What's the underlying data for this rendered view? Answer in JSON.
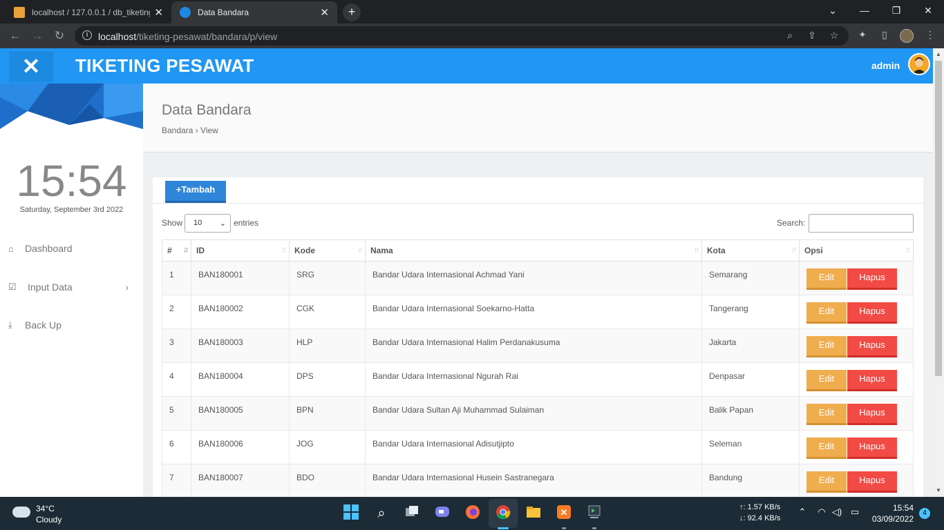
{
  "browser": {
    "tabs": [
      {
        "label": "localhost / 127.0.0.1 / db_tiketing",
        "active": false
      },
      {
        "label": "Data Bandara",
        "active": true
      }
    ],
    "url_host": "localhost",
    "url_path": "/tiketing-pesawat/bandara/p/view"
  },
  "app": {
    "brand": "TIKETING PESAWAT",
    "user": "admin",
    "accent": "#2196f3"
  },
  "sidebar": {
    "clock": "15:54",
    "date": "Saturday, September 3rd 2022",
    "items": [
      {
        "label": "Dashboard",
        "icon": "home-icon"
      },
      {
        "label": "Input Data",
        "icon": "checkbox-icon"
      },
      {
        "label": "Back Up",
        "icon": "download-icon"
      }
    ]
  },
  "header": {
    "title": "Data Bandara",
    "breadcrumb": "Bandara › View"
  },
  "panel": {
    "add_label": "+Tambah",
    "show_label": "Show",
    "entries_label": "entries",
    "entries_value": "10",
    "search_label": "Search:",
    "columns": [
      "#",
      "ID",
      "Kode",
      "Nama",
      "Kota",
      "Opsi"
    ],
    "edit_label": "Edit",
    "delete_label": "Hapus",
    "rows": [
      {
        "no": "1",
        "id": "BAN180001",
        "kode": "SRG",
        "nama": "Bandar Udara Internasional Achmad Yani",
        "kota": "Semarang"
      },
      {
        "no": "2",
        "id": "BAN180002",
        "kode": "CGK",
        "nama": "Bandar Udara Internasional Soekarno-Hatta",
        "kota": "Tangerang"
      },
      {
        "no": "3",
        "id": "BAN180003",
        "kode": "HLP",
        "nama": "Bandar Udara Internasional Halim Perdanakusuma",
        "kota": "Jakarta"
      },
      {
        "no": "4",
        "id": "BAN180004",
        "kode": "DPS",
        "nama": "Bandar Udara Internasional Ngurah Rai",
        "kota": "Denpasar"
      },
      {
        "no": "5",
        "id": "BAN180005",
        "kode": "BPN",
        "nama": "Bandar Udara Sultan Aji Muhammad Sulaiman",
        "kota": "Balik Papan"
      },
      {
        "no": "6",
        "id": "BAN180006",
        "kode": "JOG",
        "nama": "Bandar Udara Internasional Adisutjipto",
        "kota": "Seleman"
      },
      {
        "no": "7",
        "id": "BAN180007",
        "kode": "BDO",
        "nama": "Bandar Udara Internasional Husein Sastranegara",
        "kota": "Bandung"
      }
    ]
  },
  "taskbar": {
    "temp": "34°C",
    "condition": "Cloudy",
    "upload": "↑: 1.57 KB/s",
    "download": "↓: 92.4 KB/s",
    "time": "15:54",
    "date": "03/09/2022",
    "notifications": "4"
  }
}
